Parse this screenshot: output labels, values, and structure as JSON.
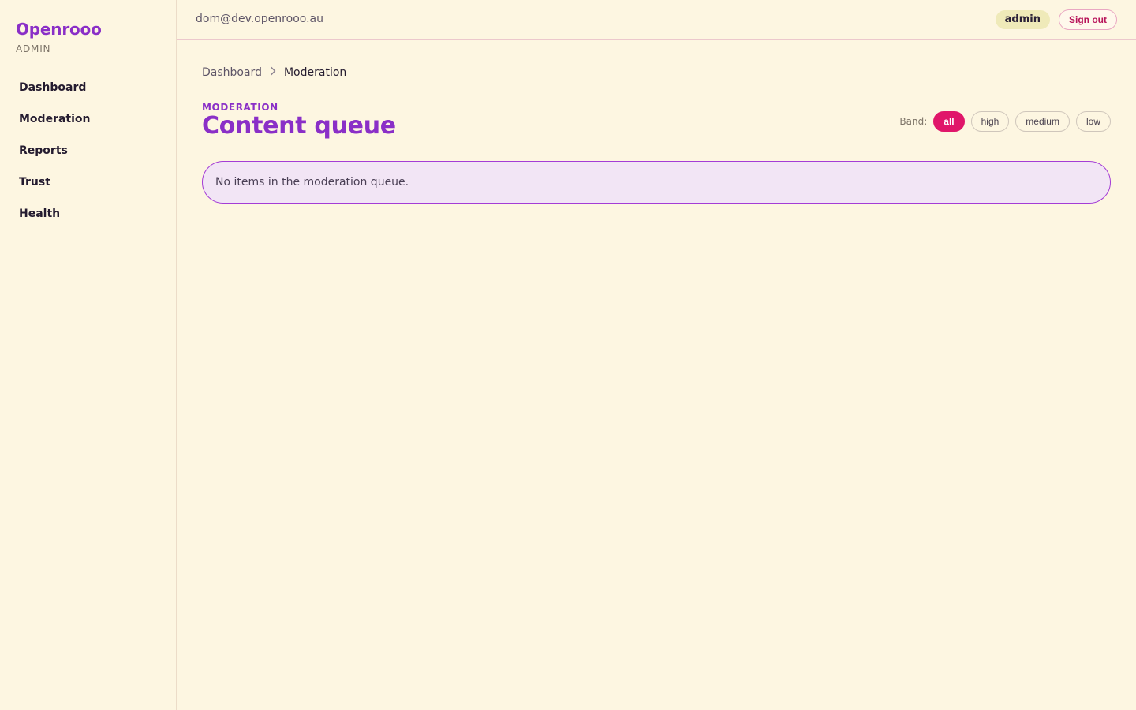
{
  "brand": {
    "name": "Openrooo",
    "subtitle": "ADMIN"
  },
  "sidebar": {
    "items": [
      {
        "label": "Dashboard"
      },
      {
        "label": "Moderation"
      },
      {
        "label": "Reports"
      },
      {
        "label": "Trust"
      },
      {
        "label": "Health"
      }
    ]
  },
  "header": {
    "user_email": "dom@dev.openrooo.au",
    "role": "admin",
    "sign_out_label": "Sign out"
  },
  "breadcrumb": {
    "items": [
      "Dashboard",
      "Moderation"
    ]
  },
  "main": {
    "eyebrow": "MODERATION",
    "title": "Content queue",
    "band_filter": {
      "label": "Band:",
      "options": [
        "all",
        "high",
        "medium",
        "low"
      ],
      "selected": "all"
    },
    "empty_message": "No items in the moderation queue."
  },
  "colors": {
    "background": "#fdf6e1",
    "brand": "#8a2fc7",
    "accent": "#e0166a",
    "role_badge": "#efeab9",
    "empty_state_bg": "#f2e5f5",
    "empty_state_border": "#a43cd6"
  }
}
